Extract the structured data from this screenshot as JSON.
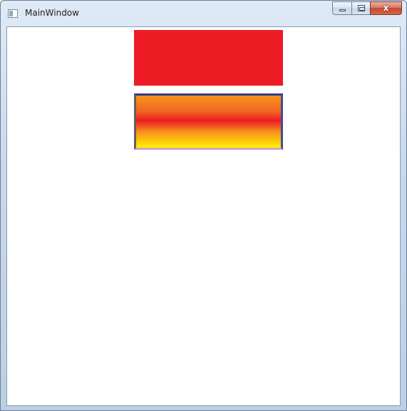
{
  "window": {
    "title": "MainWindow",
    "icon": "app-window-icon",
    "controls": {
      "minimize": "minimize-icon",
      "maximize": "maximize-icon",
      "close_glyph": "x"
    }
  },
  "content": {
    "solid_rectangle": {
      "fill": "#ed1c24"
    },
    "gradient_rectangle": {
      "gradient_stops": [
        "#f7941d",
        "#f26522",
        "#ed1c24",
        "#f7941d",
        "#fff200"
      ],
      "border_colors": [
        "#2e3a8c",
        "#3b4d9b",
        "#d8a0c8",
        "#6a5a5a"
      ]
    }
  }
}
